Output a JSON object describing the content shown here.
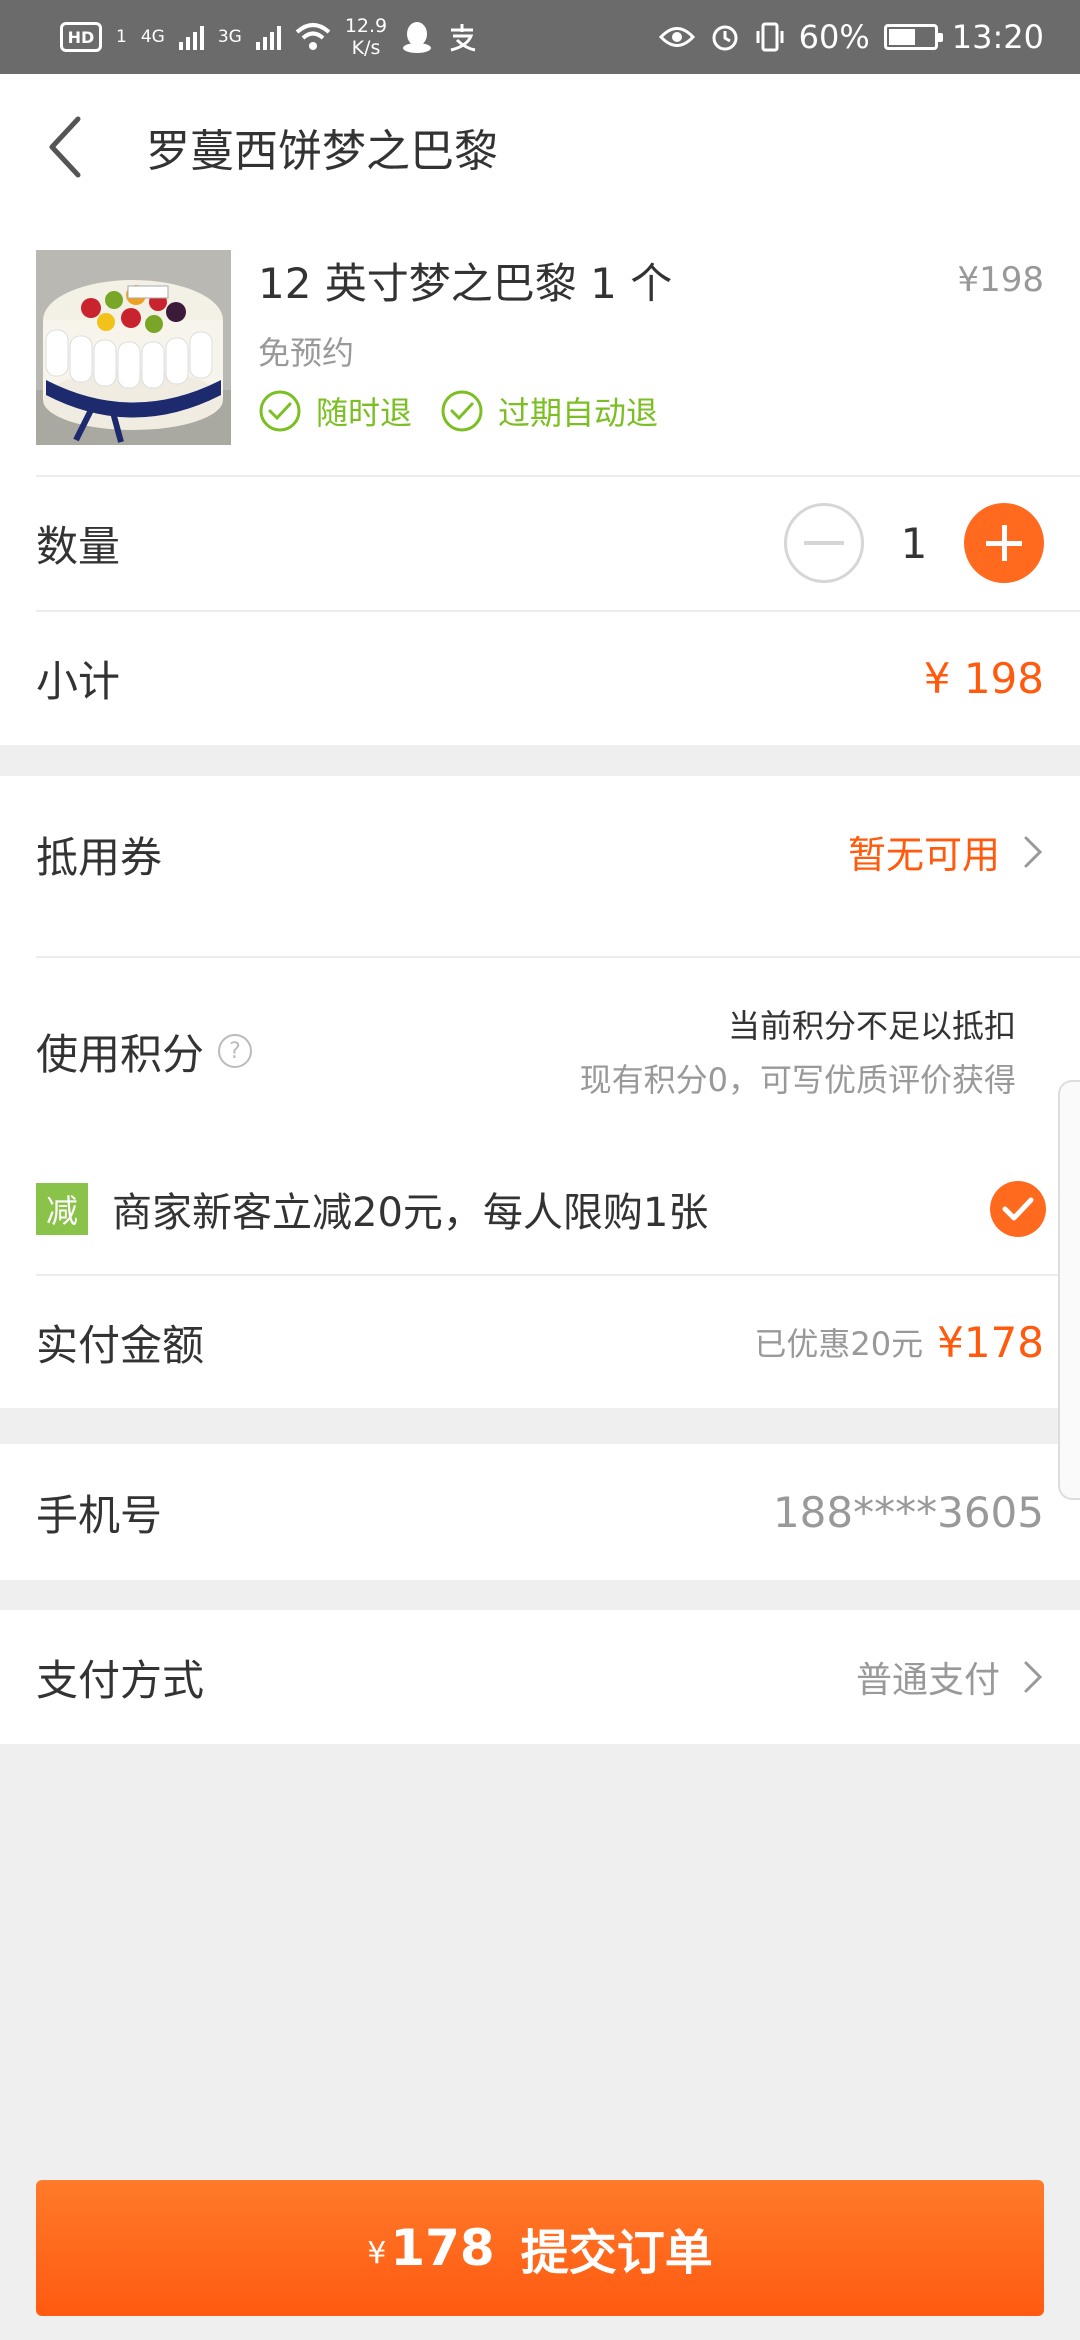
{
  "status_bar": {
    "hd": "HD",
    "sim1": "1",
    "net1": "4G",
    "net2": "3G",
    "speed_value": "12.9",
    "speed_unit": "K/s",
    "battery": "60%",
    "time": "13:20"
  },
  "header": {
    "title": "罗蔓西饼梦之巴黎"
  },
  "product": {
    "name": "12 英寸梦之巴黎 1 个",
    "price": "¥198",
    "subtitle": "免预约",
    "badges": [
      "随时退",
      "过期自动退"
    ]
  },
  "quantity": {
    "label": "数量",
    "value": "1"
  },
  "subtotal": {
    "label": "小计",
    "value": "¥ 198"
  },
  "coupon": {
    "label": "抵用券",
    "value": "暂无可用"
  },
  "points": {
    "label": "使用积分",
    "help": "?",
    "line1": "当前积分不足以抵扣",
    "line2": "现有积分0，可写优质评价获得"
  },
  "promo": {
    "tag": "减",
    "text": "商家新客立减20元，每人限购1张",
    "checked": true
  },
  "actual": {
    "label": "实付金额",
    "discount_note": "已优惠20元",
    "value": "¥178"
  },
  "phone": {
    "label": "手机号",
    "value": "188****3605"
  },
  "payment": {
    "label": "支付方式",
    "value": "普通支付"
  },
  "submit": {
    "currency": "¥",
    "amount": "178",
    "label": "提交订单"
  },
  "colors": {
    "accent": "#ff5a0e",
    "green": "#7bbf23",
    "promo_green": "#8ac34a"
  }
}
